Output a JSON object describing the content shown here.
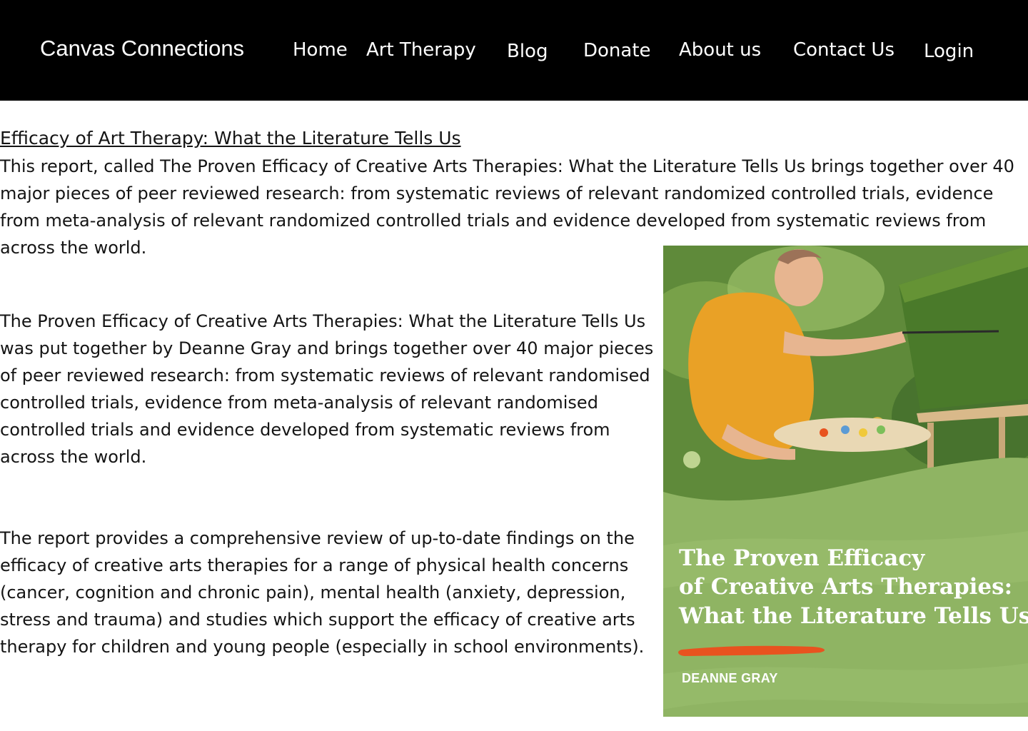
{
  "header": {
    "brand": "Canvas Connections",
    "nav": [
      {
        "label": "Home"
      },
      {
        "label": "Art Therapy"
      },
      {
        "label": "Blog"
      },
      {
        "label": "Donate"
      },
      {
        "label": "About us"
      },
      {
        "label": "Contact Us"
      },
      {
        "label": "Login"
      }
    ]
  },
  "article": {
    "title": "Efficacy of Art Therapy: What the Literature Tells Us",
    "intro": "This report, called The Proven Efficacy of Creative Arts Therapies: What the Literature Tells Us brings together over 40 major pieces of peer reviewed research: from systematic reviews of relevant randomized controlled trials, evidence from meta-analysis of relevant randomized controlled trials and evidence developed from systematic reviews from across the world.",
    "paragraphs": [
      "The Proven Efficacy of Creative Arts Therapies: What the Literature Tells Us was put together by Deanne Gray and brings together over 40 major pieces of peer reviewed research: from systematic reviews of relevant randomised controlled trials, evidence from meta-analysis of relevant randomised controlled trials and evidence developed from systematic reviews from across the world.",
      "The report provides a comprehensive review of up-to-date findings on the efficacy of creative arts therapies for a range of physical health concerns (cancer, cognition and chronic pain), mental health (anxiety, depression, stress and trauma) and studies which support the efficacy of creative arts therapy for children and young people (especially in school environments)."
    ]
  },
  "book_cover": {
    "title_lines": [
      "The Proven Efficacy",
      "of Creative Arts Therapies:",
      "What the Literature Tells Us"
    ],
    "author": "DEANNE GRAY",
    "colors": {
      "cover_green": "#8fb463",
      "shirt": "#e9a126",
      "brush_stroke": "#e8531f"
    }
  },
  "colors": {
    "header_bg": "#000000",
    "header_text": "#ffffff",
    "body_text": "#141414"
  }
}
